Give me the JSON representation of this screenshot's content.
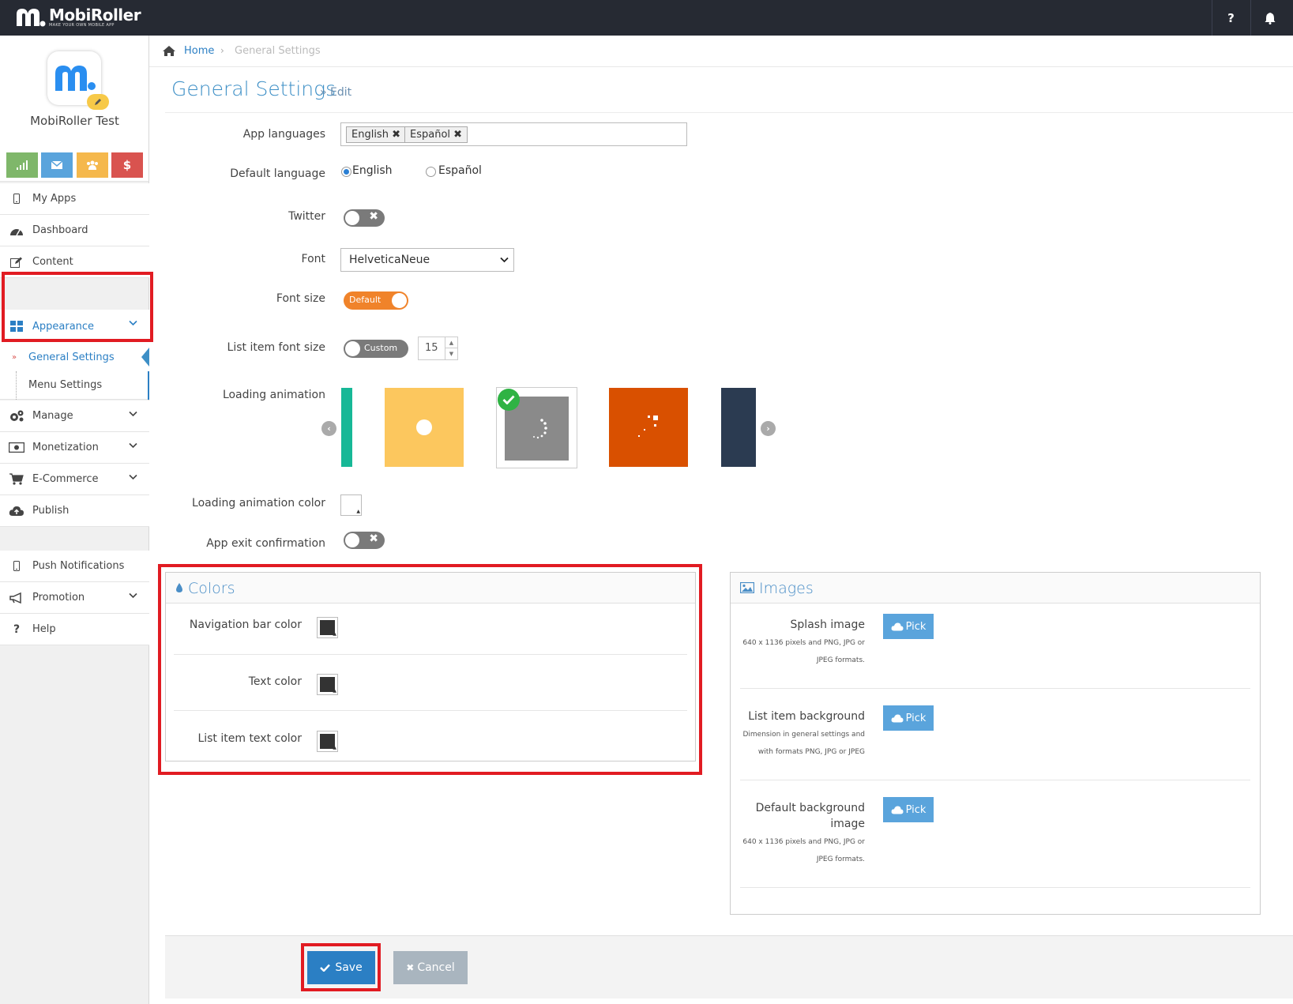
{
  "topbar": {
    "brand": "MobiRoller",
    "tagline": "MAKE YOUR OWN MOBILE APP",
    "help": "?"
  },
  "sidebar": {
    "app_name": "MobiRoller Test",
    "quick_colors": [
      "#7fb76a",
      "#5aa4dc",
      "#f5b84c",
      "#d9534f"
    ],
    "items": [
      {
        "label": "My Apps"
      },
      {
        "label": "Dashboard"
      },
      {
        "label": "Content"
      },
      {
        "label": "Appearance"
      },
      {
        "label": "Manage"
      },
      {
        "label": "Monetization"
      },
      {
        "label": "E-Commerce"
      },
      {
        "label": "Publish"
      },
      {
        "label": "Push Notifications"
      },
      {
        "label": "Promotion"
      },
      {
        "label": "Help"
      }
    ],
    "sub_items": [
      {
        "label": "General Settings"
      },
      {
        "label": "Menu Settings"
      }
    ]
  },
  "breadcrumb": {
    "home": "Home",
    "current": "General Settings"
  },
  "page": {
    "title": "General Settings",
    "subtitle": "» Edit"
  },
  "form": {
    "app_languages_label": "App languages",
    "languages": [
      "English",
      "Español"
    ],
    "default_language_label": "Default language",
    "default_language_options": [
      "English",
      "Español"
    ],
    "twitter_label": "Twitter",
    "font_label": "Font",
    "font_value": "HelveticaNeue",
    "font_size_label": "Font size",
    "font_size_toggle": "Default",
    "list_font_size_label": "List item font size",
    "list_font_size_toggle": "Custom",
    "list_font_size_value": "15",
    "loading_animation_label": "Loading animation",
    "loading_color_label": "Loading animation color",
    "exit_confirm_label": "App exit confirmation"
  },
  "colors_panel": {
    "title": "Colors",
    "rows": [
      {
        "label": "Navigation bar color"
      },
      {
        "label": "Text color"
      },
      {
        "label": "List item text color"
      }
    ]
  },
  "images_panel": {
    "title": "Images",
    "pick_label": "Pick",
    "rows": [
      {
        "label": "Splash image",
        "note1": "640 x 1136 pixels and PNG, JPG or",
        "note2": "JPEG formats."
      },
      {
        "label": "List item background",
        "note1": "Dimension in general settings and",
        "note2": "with formats PNG, JPG or JPEG"
      },
      {
        "label": "Default background",
        "label2": "image",
        "note1": "640 x 1136 pixels and PNG, JPG or",
        "note2": "JPEG formats."
      }
    ]
  },
  "actions": {
    "save": "Save",
    "cancel": "Cancel"
  },
  "theme": {
    "accent": "#3d8fc6",
    "primary_button": "#2b7fc4",
    "cancel_button": "#a9b5bf",
    "highlight": "#e11b22",
    "toggle_on": "#f0832a"
  }
}
